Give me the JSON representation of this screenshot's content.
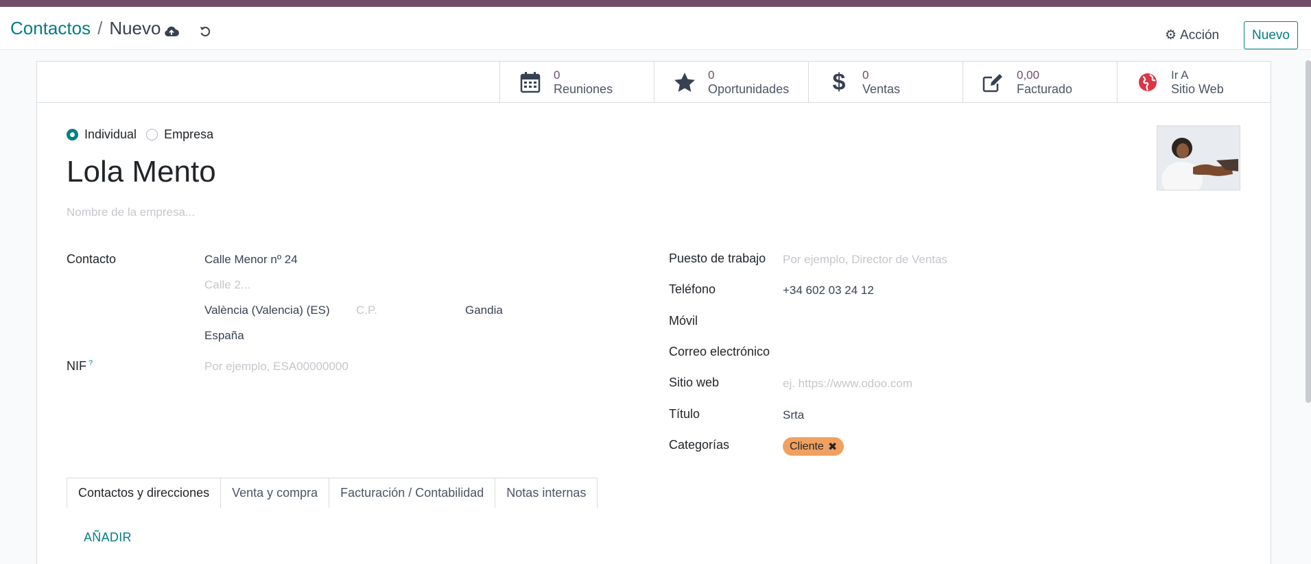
{
  "breadcrumb": {
    "parent": "Contactos",
    "separator": "/",
    "current": "Nuevo"
  },
  "toolbar": {
    "action_label": "Acción",
    "new_label": "Nuevo"
  },
  "stats": [
    {
      "value": "0",
      "label": "Reuniones",
      "icon": "calendar-icon"
    },
    {
      "value": "0",
      "label": "Oportunidades",
      "icon": "star-icon"
    },
    {
      "value": "0",
      "label": "Ventas",
      "icon": "dollar-icon"
    },
    {
      "value": "0,00",
      "label": "Facturado",
      "icon": "edit-icon"
    },
    {
      "value": "Ir A",
      "label": "Sitio Web",
      "icon": "globe-icon"
    }
  ],
  "type": {
    "individual": "Individual",
    "company": "Empresa",
    "selected": "Individual"
  },
  "partner": {
    "name": "Lola Mento",
    "company_placeholder": "Nombre de la empresa..."
  },
  "left": {
    "contact_label": "Contacto",
    "street": "Calle Menor nº 24",
    "street2_placeholder": "Calle 2...",
    "state": "València (Valencia) (ES)",
    "zip_placeholder": "C.P.",
    "city": "Gandia",
    "country": "España",
    "nif_label": "NIF",
    "nif_help": "?",
    "nif_placeholder": "Por ejemplo, ESA00000000"
  },
  "right": {
    "job_label": "Puesto de trabajo",
    "job_placeholder": "Por ejemplo, Director de Ventas",
    "phone_label": "Teléfono",
    "phone": "+34 602 03 24 12",
    "mobile_label": "Móvil",
    "email_label": "Correo electrónico",
    "website_label": "Sitio web",
    "website_placeholder": "ej. https://www.odoo.com",
    "title_label": "Título",
    "title": "Srta",
    "categories_label": "Categorías",
    "category_tag": "Cliente"
  },
  "tabs": [
    "Contactos y direcciones",
    "Venta y compra",
    "Facturación / Contabilidad",
    "Notas internas"
  ],
  "add_label": "AÑADIR",
  "colors": {
    "brand": "#714b67",
    "accent": "#017e84",
    "tag": "#f0a15f"
  }
}
